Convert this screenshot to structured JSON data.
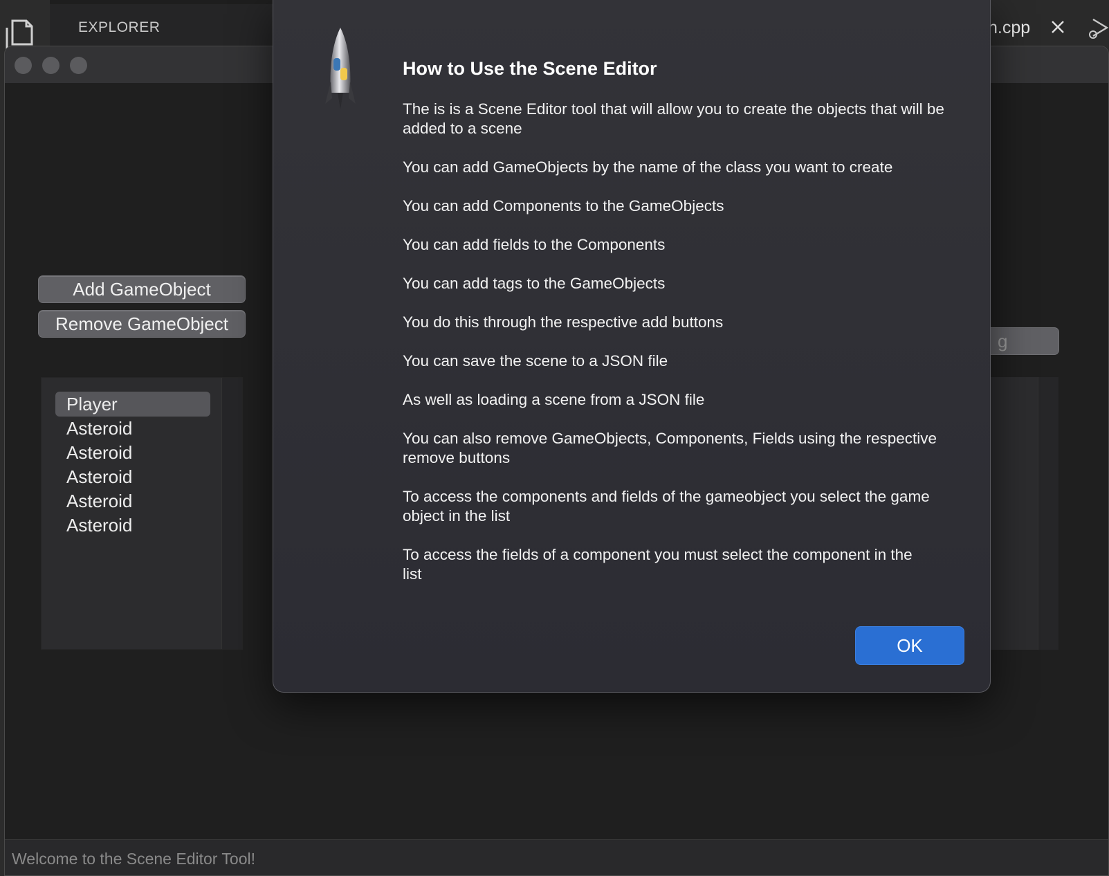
{
  "vscode": {
    "sidebar_title": "EXPLORER",
    "tab_filename": "n.cpp",
    "icons": [
      "files-icon",
      "close-icon",
      "run-debug-icon"
    ]
  },
  "app": {
    "buttons": {
      "add_gameobject": "Add GameObject",
      "remove_gameobject": "Remove GameObject",
      "add_tag_partial": "g"
    },
    "gameobjects": [
      "Player",
      "Asteroid",
      "Asteroid",
      "Asteroid",
      "Asteroid",
      "Asteroid"
    ],
    "selected_index": 0,
    "status": "Welcome to the Scene Editor Tool!"
  },
  "dialog": {
    "icon": "python-rocket-icon",
    "title": "How to Use the Scene Editor",
    "lines": [
      "The is is a Scene Editor tool that will allow you to create the objects that will be added to a scene",
      "You can add GameObjects by the name of the class you want to create",
      "You can add Components to the GameObjects",
      "You can add fields to the Components",
      "You can add tags to the GameObjects",
      "You do this through the respective add buttons",
      "You can save the scene to a JSON file",
      "As well as loading a scene from a JSON file",
      "You can also remove GameObjects, Components, Fields using the respective remove buttons",
      "To access the components and fields of the gameobject you select the game object in the list",
      "To access the fields of a component you must select the component in the list"
    ],
    "ok_label": "OK"
  },
  "colors": {
    "accent_button": "#2a6fd3",
    "dialog_bg": "#2f2f35",
    "list_selected": "#56565a"
  }
}
